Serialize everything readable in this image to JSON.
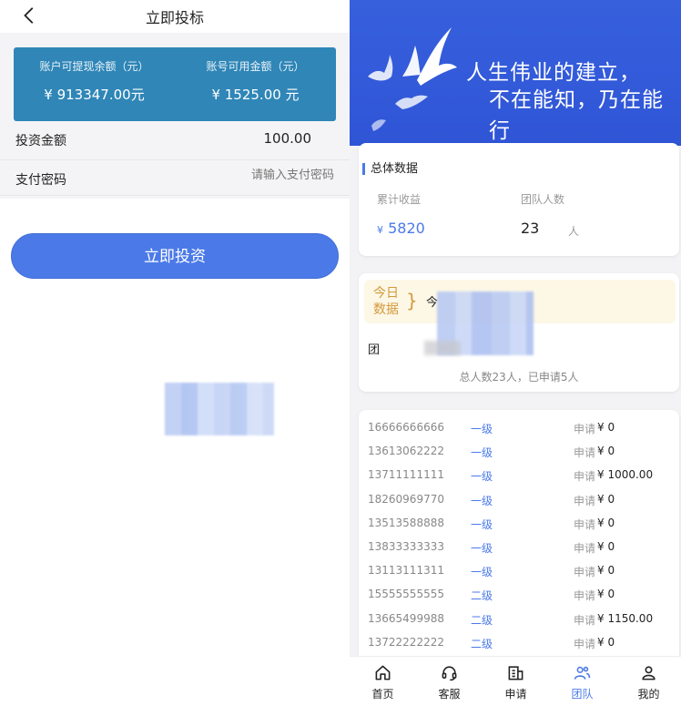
{
  "left": {
    "title": "立即投标",
    "balance": {
      "withdrawable_label": "账户可提现余额（元）",
      "withdrawable_value": "¥ 913347.00元",
      "available_label": "账号可用金额（元）",
      "available_value": "¥ 1525.00 元"
    },
    "amount_label": "投资金额",
    "amount_value": "100.00",
    "password_label": "支付密码",
    "password_placeholder": "请输入支付密码",
    "invest_button": "立即投资"
  },
  "right": {
    "banner_line1": "人生伟业的建立，",
    "banner_line2": "不在能知，乃在能行",
    "overall_title": "总体数据",
    "cum_income_label": "累计收益",
    "cum_income_currency": "¥",
    "cum_income_value": "5820",
    "team_count_label": "团队人数",
    "team_count_value": "23",
    "team_count_unit": "人",
    "today_label_l1": "今日",
    "today_label_l2": "数据",
    "today_partial": "今",
    "team_partial": "团",
    "summary": "总人数23人，已申请5人",
    "members": [
      {
        "phone": "16666666666",
        "level": "一级",
        "applied": "申请",
        "amount": "¥ 0"
      },
      {
        "phone": "13613062222",
        "level": "一级",
        "applied": "申请",
        "amount": "¥ 0"
      },
      {
        "phone": "13711111111",
        "level": "一级",
        "applied": "申请",
        "amount": "¥ 1000.00"
      },
      {
        "phone": "18260969770",
        "level": "一级",
        "applied": "申请",
        "amount": "¥ 0"
      },
      {
        "phone": "13513588888",
        "level": "一级",
        "applied": "申请",
        "amount": "¥ 0"
      },
      {
        "phone": "13833333333",
        "level": "一级",
        "applied": "申请",
        "amount": "¥ 0"
      },
      {
        "phone": "13113111311",
        "level": "一级",
        "applied": "申请",
        "amount": "¥ 0"
      },
      {
        "phone": "15555555555",
        "level": "二级",
        "applied": "申请",
        "amount": "¥ 0"
      },
      {
        "phone": "13665499988",
        "level": "二级",
        "applied": "申请",
        "amount": "¥ 1150.00"
      },
      {
        "phone": "13722222222",
        "level": "二级",
        "applied": "申请",
        "amount": "¥ 0"
      }
    ],
    "nav": [
      {
        "label": "首页",
        "icon": "home-icon"
      },
      {
        "label": "客服",
        "icon": "headset-icon"
      },
      {
        "label": "申请",
        "icon": "apply-icon"
      },
      {
        "label": "团队",
        "icon": "team-icon",
        "active": true
      },
      {
        "label": "我的",
        "icon": "user-icon"
      }
    ]
  },
  "colors": {
    "accent": "#4b7ae8",
    "balance_card": "#2f86b7",
    "banner": "#2f55d6",
    "today_text": "#d39a3a"
  }
}
